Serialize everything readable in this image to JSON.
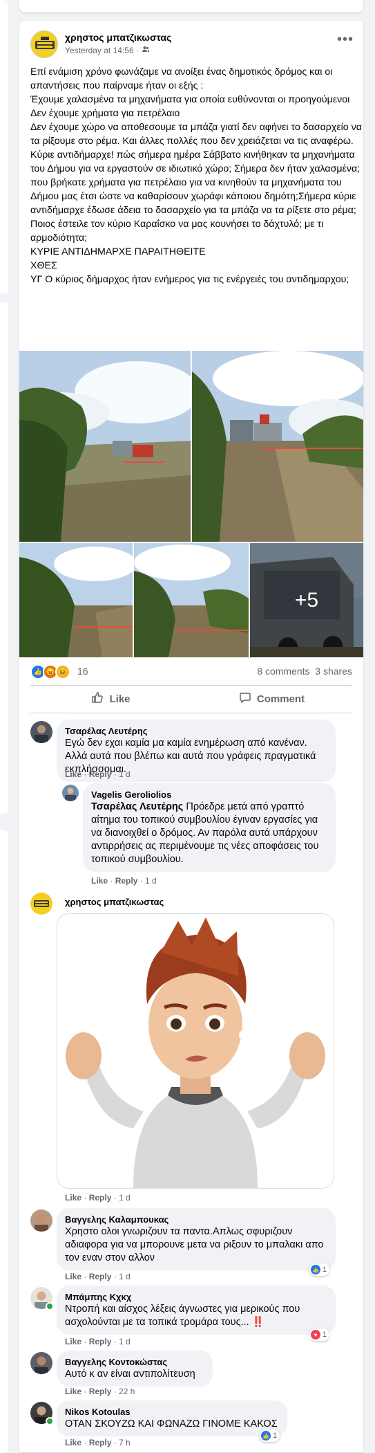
{
  "post": {
    "author": "χρηστος μπατζικωστας",
    "timestamp": "Yesterday at 14:56 ·",
    "privacy_icon": "friends-icon",
    "text_lines": [
      "Επί ενάμιση χρόνο φωνάζαμε να ανοίξει ένας δημοτικός δρόμος και οι απαντήσεις που παίρναμε ήταν οι εξής :",
      "Έχουμε χαλασμένα τα μηχανήματα για οποία ευθύνονται οι προηγούμενοι",
      "Δεν έχουμε χρήματα για πετρέλαιο",
      "Δεν έχουμε χώρο να αποθεσουμε τα μπάζα γιατί δεν αφήνει το δασαρχείο να τα ρίξουμε στο ρέμα. Και άλλες πολλές που δεν χρειάζεται να τις αναφέρω.",
      "Κύριε αντιδήμαρχε! πώς σήμερα ημέρα Σάββατο κινήθηκαν τα μηχανήματα του Δήμου για να εργαστούν σε ιδιωτικό χώρο; Σήμερα δεν ήταν χαλασμένα; που βρήκατε χρήματα για πετρέλαιο για να κινηθούν τα μηχανήματα του Δήμου μας έτσι ώστε να καθαρίσουν χωράφι κάποιου δημότη;Σήμερα κύριε αντιδήμαρχε έδωσε άδεια το δασαρχείο για τα μπάζα να τα ρίξετε στο ρέμα;",
      "Ποιος έστειλε τον κύριο Καραΐσκο να μας κουνήσει το δάχτυλό; με τι αρμοδιότητα;",
      "ΚΥΡΙΕ ΑΝΤΙΔΗΜΑΡΧΕ ΠΑΡΑΙΤΗΘΕΙΤΕ",
      "ΧΘΕΣ",
      "ΥΓ Ο κύριος δήμαρχος ήταν ενήμερος για τις ενέργειές του αντιδημαρχου;"
    ],
    "more_photos": "+5",
    "reactions_count": "16",
    "comments_count": "8 comments",
    "shares_count": "3 shares",
    "like_label": "Like",
    "comment_label": "Comment"
  },
  "comments": [
    {
      "name": "Τσαρέλας Λευτέρης",
      "tag": "",
      "text": "Εγώ δεν εχαι καμία μα καμία ενημέρωση από κανέναν. Αλλά αυτά που βλέπω και αυτά που γράφεις πραγματικά εκπλήσσομαι.",
      "like": "Like",
      "reply": "Reply",
      "time": "1 d",
      "reactions": ""
    },
    {
      "name": "Vagelis Geroliolios",
      "tag": "Τσαρέλας Λευτέρης",
      "text": " Πρόεδρε μετά από γραπτό αίτημα του τοπικού συμβουλίου έγιναν εργασίες για να διανοιχθεί ο δρόμος. Αν παρόλα αυτά υπάρχουν αντιρρήσεις ας περιμένουμε τις νέες αποφάσεις του τοπικού συμβουλίου.",
      "like": "Like",
      "reply": "Reply",
      "time": "1 d",
      "reactions": ""
    },
    {
      "name": "χρηστος μπατζικωστας",
      "tag": "",
      "text": "",
      "like": "Like",
      "reply": "Reply",
      "time": "1 d",
      "reactions": ""
    },
    {
      "name": "Βαγγελης Καλαμπουκας",
      "tag": "",
      "text": "Χρηστο ολοι γνωριζουν τα παντα.Απλως σφυριζουν αδιαφορα για να μπορουνε μετα να ριξουν το μπαλακι απο τον εναν στον αλλον",
      "like": "Like",
      "reply": "Reply",
      "time": "1 d",
      "reactions": "1"
    },
    {
      "name": "Μπάμπης Κχκχ",
      "tag": "",
      "text": "Ντροπή και αίσχος λέξεις άγνωστες για μερικούς που ασχολούνται με τα τοπικά τρομάρα τους... ‼️",
      "like": "Like",
      "reply": "Reply",
      "time": "1 d",
      "reactions": "1"
    },
    {
      "name": "Βαγγελης Κοντοκώστας",
      "tag": "",
      "text": "Αυτό κ αν είναι αντιπολίτευση",
      "like": "Like",
      "reply": "Reply",
      "time": "22 h",
      "reactions": ""
    },
    {
      "name": "Nikos Kotoulas",
      "tag": "",
      "text": "ΟΤΑΝ ΣΚΟΥΖΩ ΚΑΙ ΦΩΝΑΖΩ ΓΙΝΟΜΕ ΚΑΚΟΣ",
      "like": "Like",
      "reply": "Reply",
      "time": "7 h",
      "reactions": "1"
    }
  ],
  "colors": {
    "like_blue": "#1877f2",
    "love_red": "#f33e58",
    "haha_yellow": "#f7b125",
    "text_secondary": "#65676b"
  }
}
